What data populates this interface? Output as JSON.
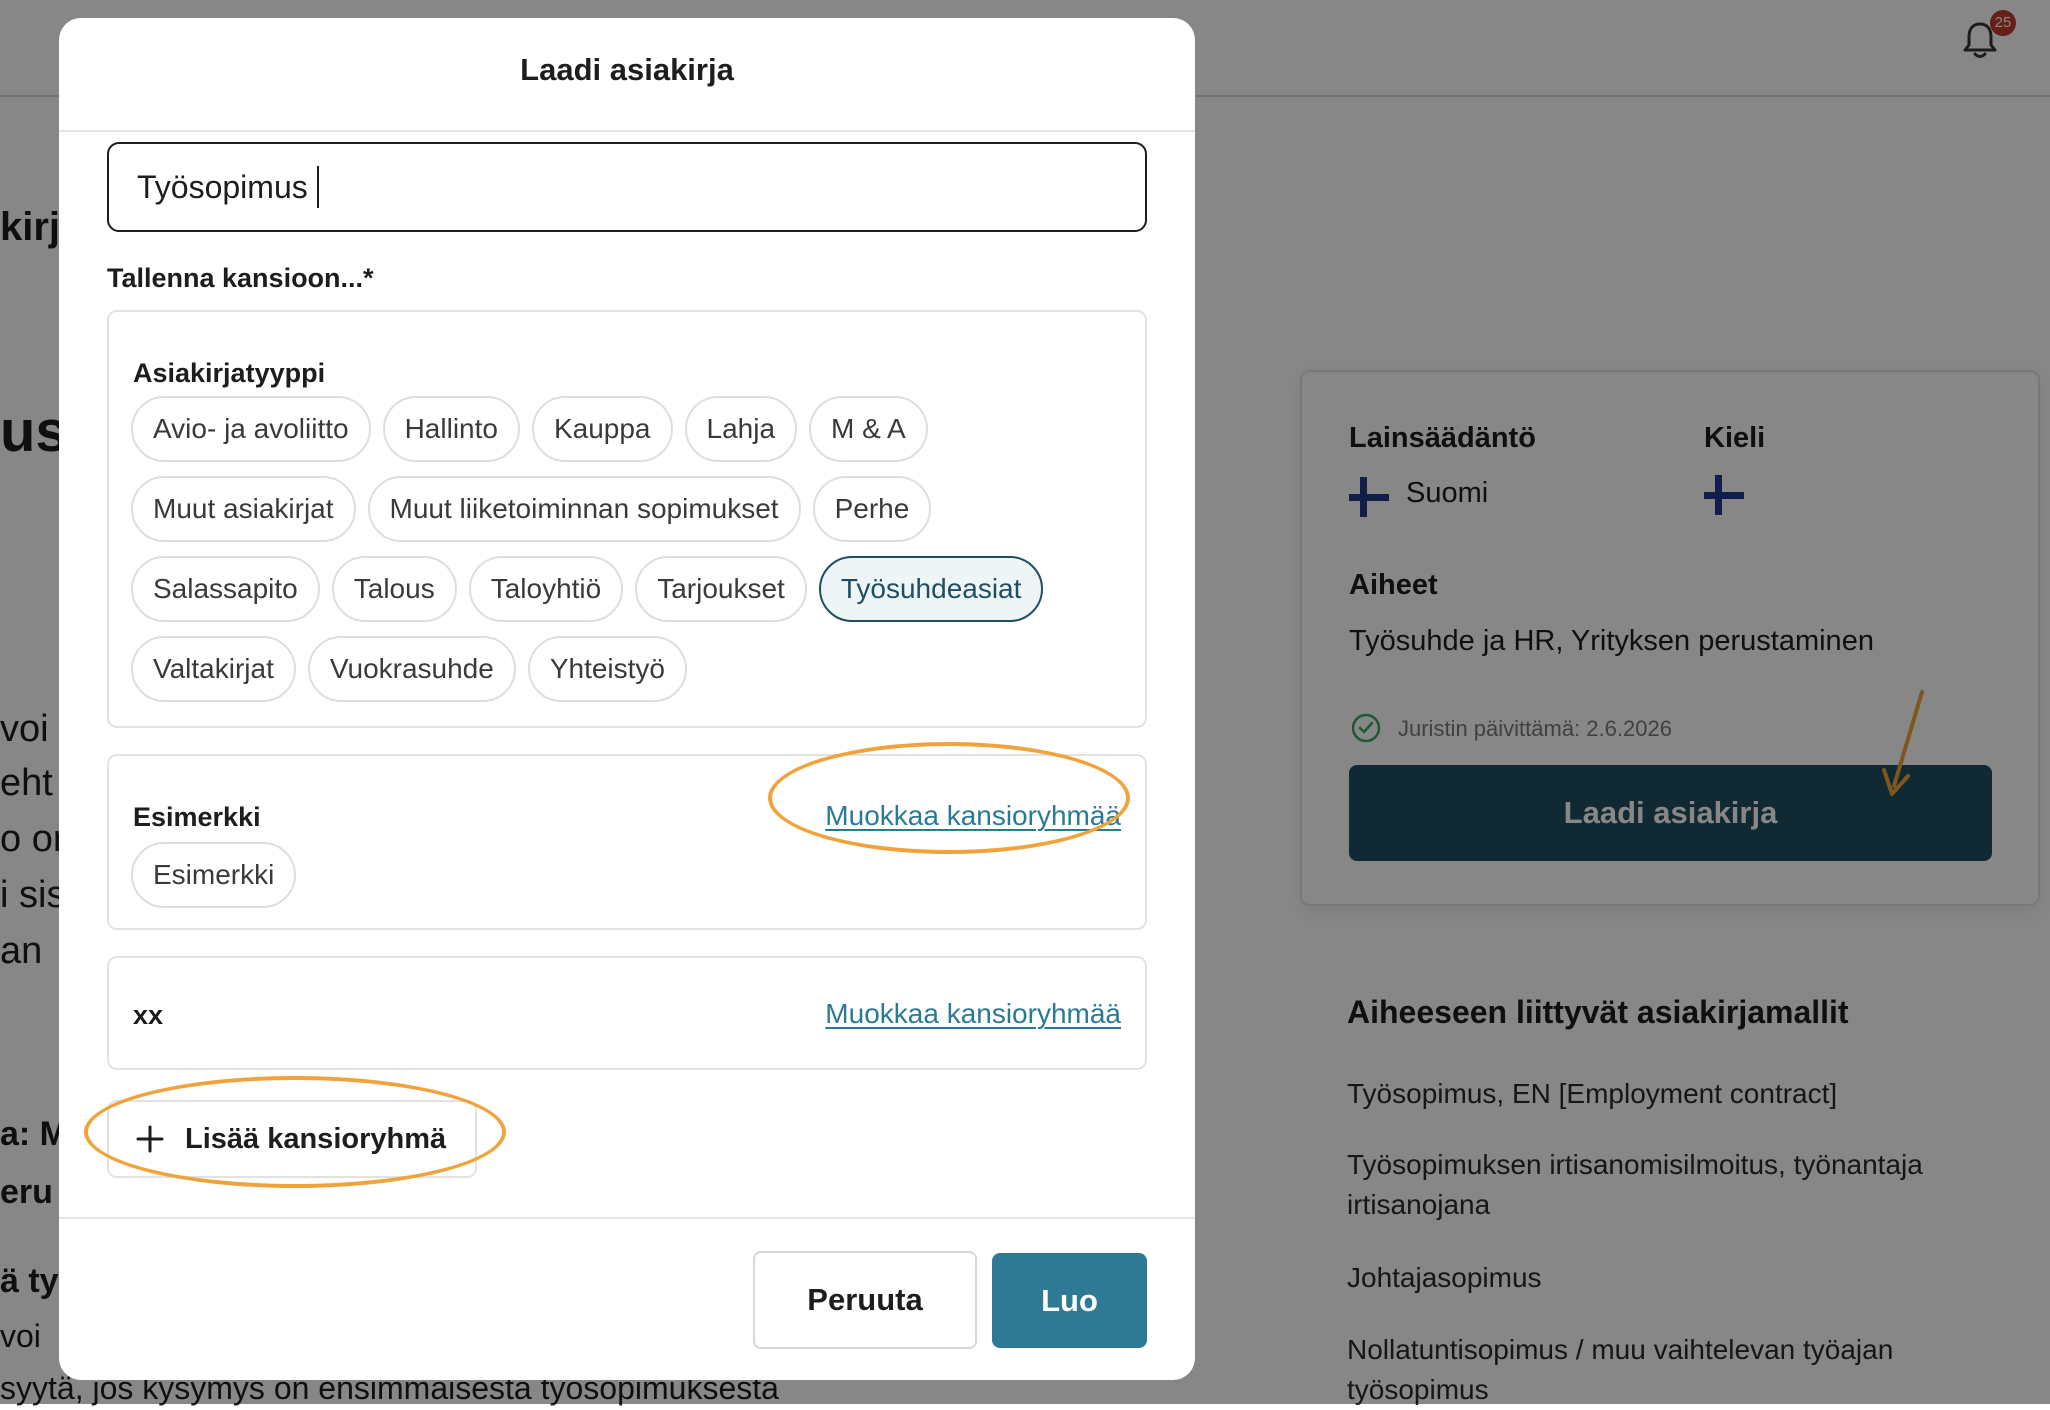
{
  "background": {
    "notification_count": "25",
    "left_fragments": [
      "kirj",
      "us",
      "voi",
      "eht",
      "o or",
      "i sis",
      "an",
      "a: M",
      "eru",
      "ä ty",
      "voi",
      "syytä, jos kysymys on ensimmäisestä työsopimuksesta"
    ],
    "info_card": {
      "legislation_label": "Lainsäädäntö",
      "legislation_value": "Suomi",
      "language_label": "Kieli",
      "topics_label": "Aiheet",
      "topics_value": "Työsuhde ja HR,  Yrityksen perustaminen",
      "updated_text": "Juristin päivittämä: 2.6.2026",
      "button_label": "Laadi asiakirja"
    },
    "related": {
      "title": "Aiheeseen liittyvät asiakirjamallit",
      "items": [
        "Työsopimus, EN [Employment contract]",
        "Työsopimuksen irtisanomisilmoitus, työnantaja irtisanojana",
        "Johtajasopimus",
        "Nollatuntisopimus / muu vaihtelevan työajan työsopimus"
      ]
    }
  },
  "modal": {
    "title": "Laadi asiakirja",
    "name_value": "Työsopimus",
    "save_label": "Tallenna kansioon...*",
    "groups": [
      {
        "title": "Asiakirjatyyppi",
        "chips": [
          "Avio- ja avoliitto",
          "Hallinto",
          "Kauppa",
          "Lahja",
          "M & A",
          "Muut asiakirjat",
          "Muut liiketoiminnan sopimukset",
          "Perhe",
          "Salassapito",
          "Talous",
          "Taloyhtiö",
          "Tarjoukset",
          "Työsuhdeasiat",
          "Valtakirjat",
          "Vuokrasuhde",
          "Yhteistyö"
        ],
        "selected": "Työsuhdeasiat"
      },
      {
        "title": "Esimerkki",
        "link": "Muokkaa kansioryhmää",
        "chips": [
          "Esimerkki"
        ]
      },
      {
        "title": "xx",
        "link": "Muokkaa kansioryhmää",
        "chips": []
      }
    ],
    "add_group_label": "Lisää kansioryhmä",
    "cancel_label": "Peruuta",
    "create_label": "Luo"
  },
  "colors": {
    "primary_dark": "#1f4e60",
    "primary": "#2e7a94",
    "annotation": "#f0a33a"
  }
}
